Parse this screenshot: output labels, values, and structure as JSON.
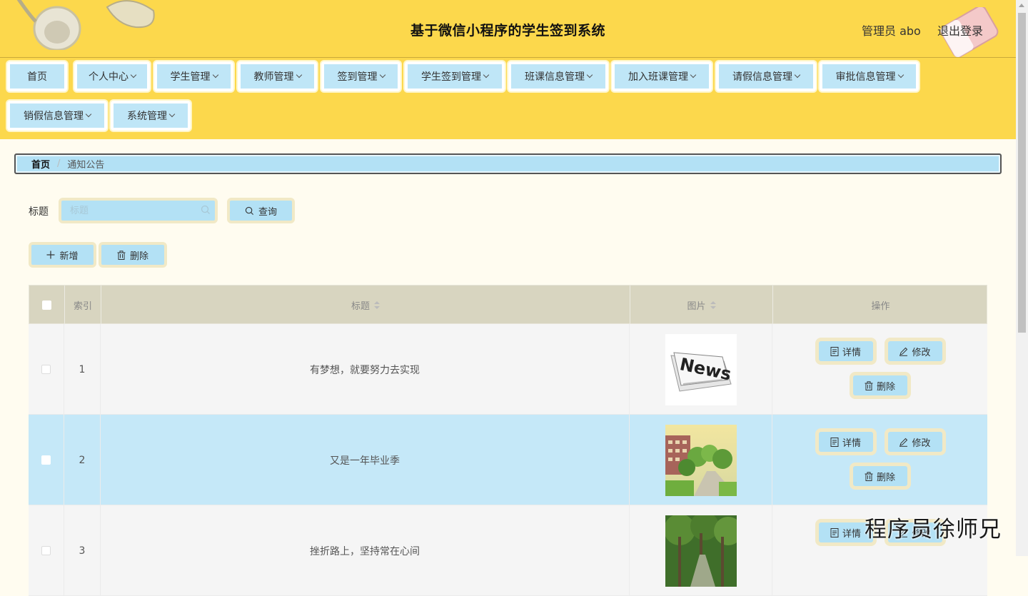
{
  "header": {
    "title": "基于微信小程序的学生签到系统",
    "admin_label": "管理员 abo",
    "logout_label": "退出登录"
  },
  "nav": {
    "items": [
      {
        "label": "首页",
        "dropdown": false
      },
      {
        "label": "个人中心",
        "dropdown": true
      },
      {
        "label": "学生管理",
        "dropdown": true
      },
      {
        "label": "教师管理",
        "dropdown": true
      },
      {
        "label": "签到管理",
        "dropdown": true
      },
      {
        "label": "学生签到管理",
        "dropdown": true
      },
      {
        "label": "班课信息管理",
        "dropdown": true
      },
      {
        "label": "加入班课管理",
        "dropdown": true
      },
      {
        "label": "请假信息管理",
        "dropdown": true
      },
      {
        "label": "审批信息管理",
        "dropdown": true
      },
      {
        "label": "销假信息管理",
        "dropdown": true
      },
      {
        "label": "系统管理",
        "dropdown": true
      }
    ]
  },
  "breadcrumb": {
    "home": "首页",
    "separator": "/",
    "current": "通知公告"
  },
  "search": {
    "label": "标题",
    "placeholder": "标题",
    "query_button": "查询"
  },
  "actions": {
    "add_button": "新增",
    "delete_button": "删除"
  },
  "table": {
    "headers": {
      "index": "索引",
      "title": "标题",
      "image": "图片",
      "ops": "操作"
    },
    "row_buttons": {
      "detail": "详情",
      "edit": "修改",
      "delete": "删除"
    },
    "rows": [
      {
        "index": "1",
        "title": "有梦想，就要努力去实现",
        "image": "news-image"
      },
      {
        "index": "2",
        "title": "又是一年毕业季",
        "image": "campus-image"
      },
      {
        "index": "3",
        "title": "挫折路上，坚持常在心间",
        "image": "trees-image"
      }
    ]
  },
  "watermark": "程序员徐师兄",
  "colors": {
    "header_bg": "#fcd84c",
    "button_bg": "#b3e1f5",
    "button_border": "#f1e9c6",
    "table_header_bg": "#d8d5c0",
    "row_highlight": "#c5e8f8",
    "row_alt": "#f5f5f5",
    "page_bg": "#fffcf0"
  }
}
